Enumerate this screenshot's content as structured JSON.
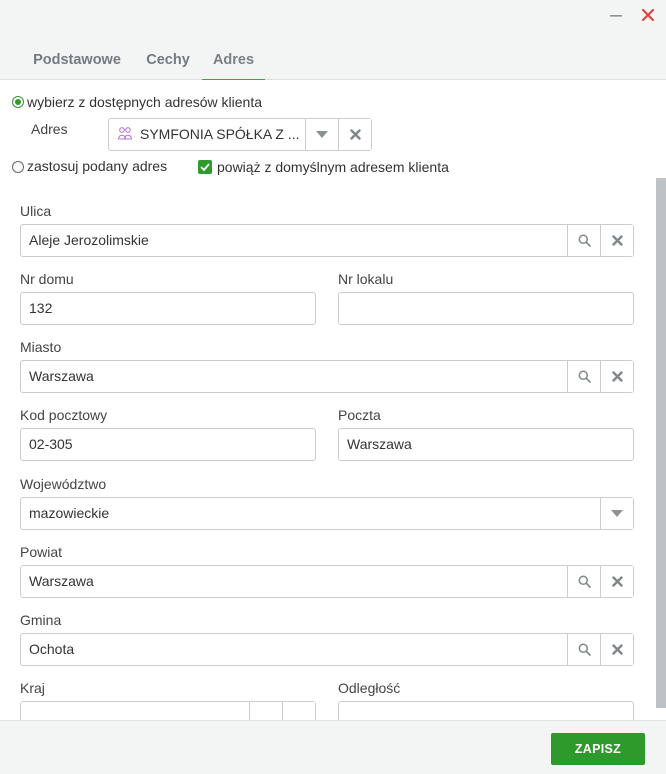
{
  "tabs": [
    {
      "label": "Podstawowe"
    },
    {
      "label": "Cechy"
    },
    {
      "label": "Adres"
    }
  ],
  "address_source": {
    "option_existing_label": "wybierz z dostępnych adresów klienta",
    "address_label": "Adres",
    "address_value": "SYMFONIA SPÓŁKA Z ...",
    "option_custom_label": "zastosuj podany adres",
    "link_default_label": "powiąż z domyślnym adresem klienta"
  },
  "form": {
    "street": {
      "label": "Ulica",
      "value": "Aleje Jerozolimskie"
    },
    "house_no": {
      "label": "Nr domu",
      "value": "132"
    },
    "apartment_no": {
      "label": "Nr lokalu",
      "value": ""
    },
    "city": {
      "label": "Miasto",
      "value": "Warszawa"
    },
    "postal_code": {
      "label": "Kod pocztowy",
      "value": "02-305"
    },
    "post_office": {
      "label": "Poczta",
      "value": "Warszawa"
    },
    "voivodeship": {
      "label": "Województwo",
      "value": "mazowieckie"
    },
    "county": {
      "label": "Powiat",
      "value": "Warszawa"
    },
    "commune": {
      "label": "Gmina",
      "value": "Ochota"
    },
    "country": {
      "label": "Kraj",
      "value": ""
    },
    "distance": {
      "label": "Odległość",
      "value": ""
    }
  },
  "footer": {
    "save_label": "ZAPISZ"
  },
  "colors": {
    "accent": "#2e9a2c",
    "close": "#e0403a"
  }
}
